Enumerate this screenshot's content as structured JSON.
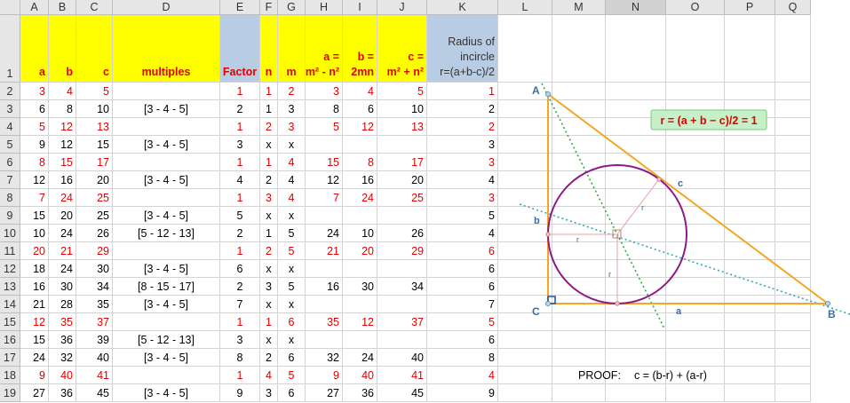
{
  "columns": [
    "A",
    "B",
    "C",
    "D",
    "E",
    "F",
    "G",
    "H",
    "I",
    "J",
    "K",
    "L",
    "M",
    "N",
    "O",
    "P",
    "Q"
  ],
  "header_row": {
    "a": "a",
    "b": "b",
    "c": "c",
    "multiples": "multiples",
    "factor": "Factor",
    "n": "n",
    "m": "m",
    "h1": "a =",
    "h2": "m² - n²",
    "i1": "b =",
    "i2": "2mn",
    "j1": "c =",
    "j2": "m² + n²",
    "k1": "Radius of",
    "k2": "incircle",
    "k3": "r=(a+b-c)/2"
  },
  "rows": [
    {
      "n": "2",
      "a": "3",
      "b": "4",
      "c": "5",
      "mult": "",
      "f": "1",
      "nn": "1",
      "m": "2",
      "h": "3",
      "i": "4",
      "j": "5",
      "k": "1",
      "red": true
    },
    {
      "n": "3",
      "a": "6",
      "b": "8",
      "c": "10",
      "mult": "[3 - 4 - 5]",
      "f": "2",
      "nn": "1",
      "m": "3",
      "h": "8",
      "i": "6",
      "j": "10",
      "k": "2",
      "red": false
    },
    {
      "n": "4",
      "a": "5",
      "b": "12",
      "c": "13",
      "mult": "",
      "f": "1",
      "nn": "2",
      "m": "3",
      "h": "5",
      "i": "12",
      "j": "13",
      "k": "2",
      "red": true
    },
    {
      "n": "5",
      "a": "9",
      "b": "12",
      "c": "15",
      "mult": "[3 - 4 - 5]",
      "f": "3",
      "nn": "x",
      "m": "x",
      "h": "",
      "i": "",
      "j": "",
      "k": "3",
      "red": false
    },
    {
      "n": "6",
      "a": "8",
      "b": "15",
      "c": "17",
      "mult": "",
      "f": "1",
      "nn": "1",
      "m": "4",
      "h": "15",
      "i": "8",
      "j": "17",
      "k": "3",
      "red": true
    },
    {
      "n": "7",
      "a": "12",
      "b": "16",
      "c": "20",
      "mult": "[3 - 4 - 5]",
      "f": "4",
      "nn": "2",
      "m": "4",
      "h": "12",
      "i": "16",
      "j": "20",
      "k": "4",
      "red": false
    },
    {
      "n": "8",
      "a": "7",
      "b": "24",
      "c": "25",
      "mult": "",
      "f": "1",
      "nn": "3",
      "m": "4",
      "h": "7",
      "i": "24",
      "j": "25",
      "k": "3",
      "red": true
    },
    {
      "n": "9",
      "a": "15",
      "b": "20",
      "c": "25",
      "mult": "[3 - 4 - 5]",
      "f": "5",
      "nn": "x",
      "m": "x",
      "h": "",
      "i": "",
      "j": "",
      "k": "5",
      "red": false
    },
    {
      "n": "10",
      "a": "10",
      "b": "24",
      "c": "26",
      "mult": "[5 - 12 - 13]",
      "f": "2",
      "nn": "1",
      "m": "5",
      "h": "24",
      "i": "10",
      "j": "26",
      "k": "4",
      "red": false
    },
    {
      "n": "11",
      "a": "20",
      "b": "21",
      "c": "29",
      "mult": "",
      "f": "1",
      "nn": "2",
      "m": "5",
      "h": "21",
      "i": "20",
      "j": "29",
      "k": "6",
      "red": true
    },
    {
      "n": "12",
      "a": "18",
      "b": "24",
      "c": "30",
      "mult": "[3 - 4 - 5]",
      "f": "6",
      "nn": "x",
      "m": "x",
      "h": "",
      "i": "",
      "j": "",
      "k": "6",
      "red": false
    },
    {
      "n": "13",
      "a": "16",
      "b": "30",
      "c": "34",
      "mult": "[8 - 15 - 17]",
      "f": "2",
      "nn": "3",
      "m": "5",
      "h": "16",
      "i": "30",
      "j": "34",
      "k": "6",
      "red": false
    },
    {
      "n": "14",
      "a": "21",
      "b": "28",
      "c": "35",
      "mult": "[3 - 4 - 5]",
      "f": "7",
      "nn": "x",
      "m": "x",
      "h": "",
      "i": "",
      "j": "",
      "k": "7",
      "red": false
    },
    {
      "n": "15",
      "a": "12",
      "b": "35",
      "c": "37",
      "mult": "",
      "f": "1",
      "nn": "1",
      "m": "6",
      "h": "35",
      "i": "12",
      "j": "37",
      "k": "5",
      "red": true
    },
    {
      "n": "16",
      "a": "15",
      "b": "36",
      "c": "39",
      "mult": "[5 - 12 - 13]",
      "f": "3",
      "nn": "x",
      "m": "x",
      "h": "",
      "i": "",
      "j": "",
      "k": "6",
      "red": false
    },
    {
      "n": "17",
      "a": "24",
      "b": "32",
      "c": "40",
      "mult": "[3 - 4 - 5]",
      "f": "8",
      "nn": "2",
      "m": "6",
      "h": "32",
      "i": "24",
      "j": "40",
      "k": "8",
      "red": false
    },
    {
      "n": "18",
      "a": "9",
      "b": "40",
      "c": "41",
      "mult": "",
      "f": "1",
      "nn": "4",
      "m": "5",
      "h": "9",
      "i": "40",
      "j": "41",
      "k": "4",
      "red": true
    },
    {
      "n": "19",
      "a": "27",
      "b": "36",
      "c": "45",
      "mult": "[3 - 4 - 5]",
      "f": "9",
      "nn": "3",
      "m": "6",
      "h": "27",
      "i": "36",
      "j": "45",
      "k": "9",
      "red": false
    }
  ],
  "diagram": {
    "formula": "r = (a + b − c)/2 = 1",
    "label_A": "A",
    "label_B": "B",
    "label_C": "C",
    "label_a": "a",
    "label_b": "b",
    "label_c": "c",
    "label_r": "r",
    "colors": {
      "triangle": "#f5a623",
      "circle": "#8b1a8b",
      "bisector1": "#2eaa3c",
      "bisector2": "#2aa9b6",
      "formula_bg": "#c8f0c8",
      "formula_text": "#e00000"
    }
  },
  "proof": {
    "label": "PROOF:",
    "text": "c = (b-r) + (a-r)"
  },
  "colors": {
    "yellow": "#ffff00",
    "blue_header": "#b8cce4",
    "red": "#e00000"
  }
}
